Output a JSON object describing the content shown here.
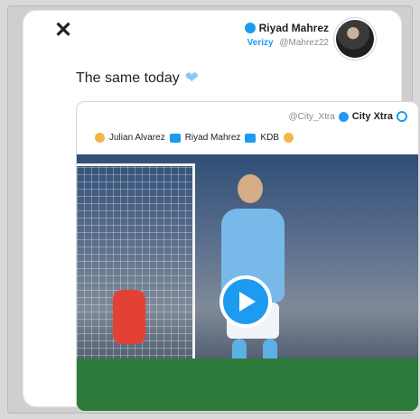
{
  "post": {
    "logo_glyph": "✕",
    "display_name": "Riyad Mahrez",
    "handle_tag": "Verizy",
    "handle": "@Mahrez22",
    "text": "The same today",
    "heart": "❤"
  },
  "embed": {
    "handle": "@City_Xtra",
    "name": "City Xtra",
    "line": [
      "Julian Alvarez",
      "Riyad Mahrez",
      "KDB"
    ]
  },
  "colors": {
    "accent": "#1d9bf0",
    "background": "#d9d9d9",
    "card": "#ffffff"
  },
  "icons": {
    "logo": "x-logo-icon",
    "verified": "verified-badge-icon",
    "play": "play-icon"
  }
}
